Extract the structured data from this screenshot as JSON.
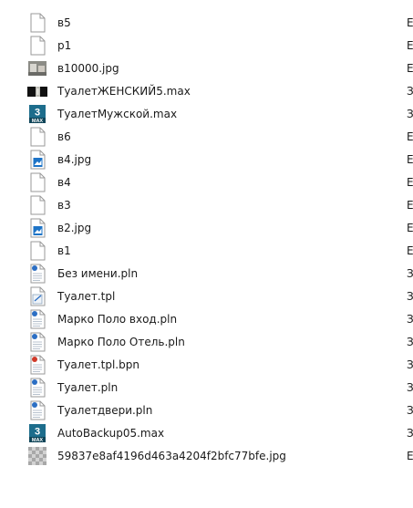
{
  "files": [
    {
      "name": "в5",
      "icon": "blank-file-icon",
      "col2": "Е"
    },
    {
      "name": "р1",
      "icon": "blank-file-icon",
      "col2": "Е"
    },
    {
      "name": "в10000.jpg",
      "icon": "image-thumbnail-icon",
      "col2": "Е"
    },
    {
      "name": "ТуалетЖЕНСКИЙ5.max",
      "icon": "dark-thumbnail-icon",
      "col2": "З"
    },
    {
      "name": "ТуалетМужской.max",
      "icon": "3dsmax-file-icon",
      "col2": "З"
    },
    {
      "name": "в6",
      "icon": "blank-file-icon",
      "col2": "Е"
    },
    {
      "name": "в4.jpg",
      "icon": "photo-file-icon",
      "col2": "Е"
    },
    {
      "name": "в4",
      "icon": "blank-file-icon",
      "col2": "Е"
    },
    {
      "name": "в3",
      "icon": "blank-file-icon",
      "col2": "Е"
    },
    {
      "name": "в2.jpg",
      "icon": "photo-file-icon",
      "col2": "Е"
    },
    {
      "name": "в1",
      "icon": "blank-file-icon",
      "col2": "Е"
    },
    {
      "name": "Без имени.pln",
      "icon": "archicad-pln-icon",
      "col2": "З"
    },
    {
      "name": "Туалет.tpl",
      "icon": "archicad-tpl-icon",
      "col2": "З"
    },
    {
      "name": "Марко Поло вход.pln",
      "icon": "archicad-pln-icon",
      "col2": "З"
    },
    {
      "name": "Марко Поло Отель.pln",
      "icon": "archicad-pln-icon",
      "col2": "З"
    },
    {
      "name": "Туалет.tpl.bpn",
      "icon": "archicad-bpn-icon",
      "col2": "З"
    },
    {
      "name": "Туалет.pln",
      "icon": "archicad-pln-icon",
      "col2": "З"
    },
    {
      "name": "Туалетдвери.pln",
      "icon": "archicad-pln-icon",
      "col2": "З"
    },
    {
      "name": "AutoBackup05.max",
      "icon": "3dsmax-file-icon",
      "col2": "З"
    },
    {
      "name": "59837e8af4196d463a4204f2bfc77bfe.jpg",
      "icon": "grid-thumbnail-icon",
      "col2": "Е"
    }
  ],
  "max_icon_text": {
    "digit": "3",
    "label": "MAX"
  }
}
